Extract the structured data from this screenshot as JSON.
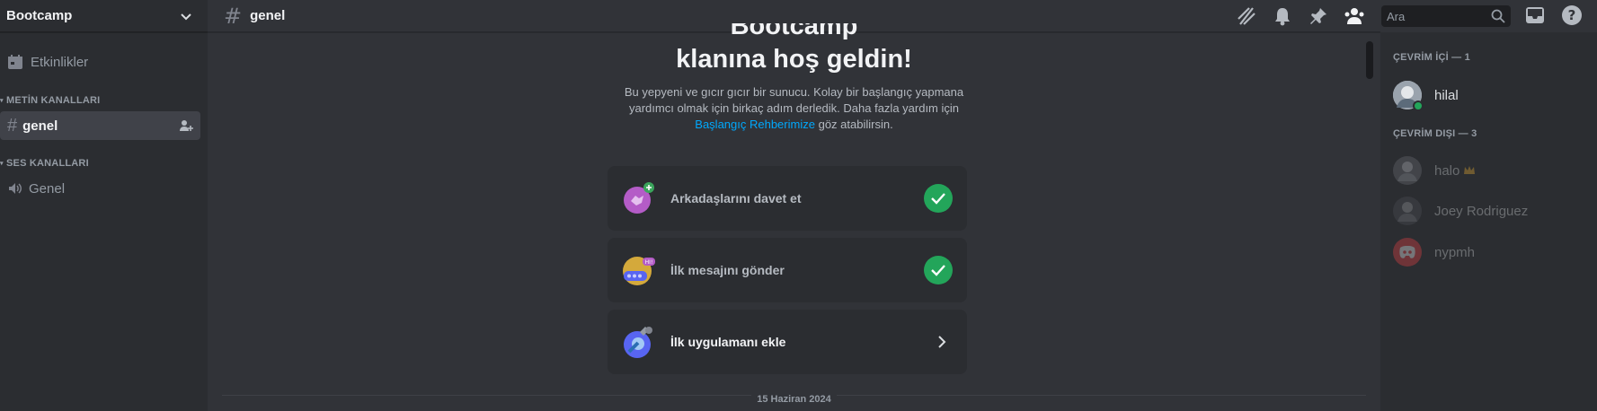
{
  "server": {
    "name": "Bootcamp"
  },
  "sidebar": {
    "events_label": "Etkinlikler",
    "text_category": "METİN KANALLARI",
    "voice_category": "SES KANALLARI",
    "text_channels": [
      {
        "name": "genel"
      }
    ],
    "voice_channels": [
      {
        "name": "Genel"
      }
    ]
  },
  "topbar": {
    "channel": "genel",
    "search_placeholder": "Ara",
    "icons": [
      "threads-icon",
      "bell-icon",
      "pin-icon",
      "members-icon",
      "inbox-icon",
      "help-icon"
    ]
  },
  "welcome": {
    "title_line1": "Bootcamp",
    "title_line2": "klanına hoş geldin!",
    "desc_before": "Bu yepyeni ve gıcır gıcır bir sunucu. Kolay bir başlangıç yapmana yardımcı olmak için birkaç adım derledik. Daha fazla yardım için",
    "desc_link": "Başlangıç Rehberimize",
    "desc_after": "göz atabilirsin."
  },
  "tasks": [
    {
      "label": "Arkadaşlarını davet et",
      "done": true
    },
    {
      "label": "İlk mesajını gönder",
      "done": true
    },
    {
      "label": "İlk uygulamanı ekle",
      "done": false
    }
  ],
  "date_divider": "15 Haziran 2024",
  "members": {
    "online_header": "ÇEVRİM İÇİ — 1",
    "offline_header": "ÇEVRİM DIŞI — 3",
    "online": [
      {
        "name": "hilal"
      }
    ],
    "offline": [
      {
        "name": "halo"
      },
      {
        "name": "Joey Rodriguez"
      },
      {
        "name": "nypmh"
      }
    ]
  },
  "colors": {
    "accent_green": "#23a55a",
    "link": "#00a8fc",
    "bg_main": "#313338",
    "bg_side": "#2b2d31"
  }
}
